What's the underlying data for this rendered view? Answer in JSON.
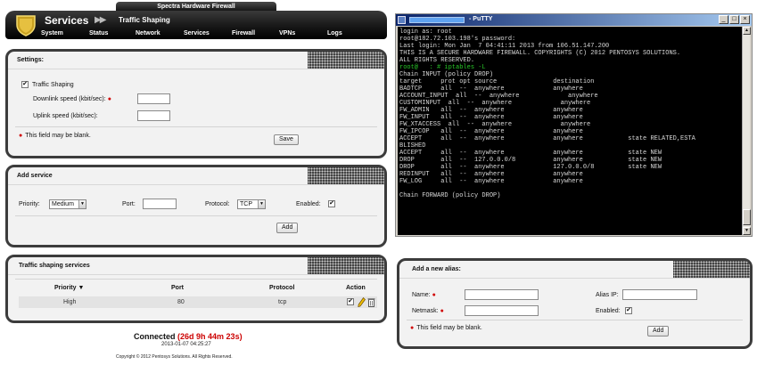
{
  "app": {
    "product_name": "Spectra Hardware Firewall",
    "section": "Services",
    "page": "Traffic Shaping",
    "nav": [
      "System",
      "Status",
      "Network",
      "Services",
      "Firewall",
      "VPNs",
      "Logs"
    ]
  },
  "settings": {
    "title": "Settings:",
    "traffic_shaping_label": "Traffic Shaping",
    "traffic_shaping_checked": true,
    "downlink_label": "Downlink speed (kbit/sec):",
    "downlink_value": "",
    "uplink_label": "Uplink speed (kbit/sec):",
    "uplink_value": "",
    "blank_note": "This field may be blank.",
    "save_label": "Save"
  },
  "add_service": {
    "title": "Add service",
    "priority_label": "Priority:",
    "priority_value": "Medium",
    "port_label": "Port:",
    "port_value": "",
    "protocol_label": "Protocol:",
    "protocol_value": "TCP",
    "enabled_label": "Enabled:",
    "enabled_checked": true,
    "add_label": "Add"
  },
  "services_table": {
    "title": "Traffic shaping services",
    "columns": [
      "Priority",
      "Port",
      "Protocol",
      "Action"
    ],
    "sort_indicator": "▼",
    "rows": [
      {
        "priority": "High",
        "port": "80",
        "protocol": "tcp"
      }
    ]
  },
  "status": {
    "connected_label": "Connected",
    "uptime": "(26d 9h 44m 23s)",
    "date": "2013-01-07 04:25:27",
    "copyright": "Copyright © 2012 Pentosys Solutions. All Rights Reserved."
  },
  "alias": {
    "title": "Add a new alias:",
    "name_label": "Name:",
    "name_value": "",
    "alias_ip_label": "Alias IP:",
    "alias_ip_value": "",
    "netmask_label": "Netmask:",
    "netmask_value": "",
    "enabled_label": "Enabled:",
    "enabled_checked": true,
    "blank_note": "This field may be blank.",
    "add_label": "Add"
  },
  "putty": {
    "title": "- PuTTY",
    "lines": [
      "login as: root",
      "root@182.72.103.198's password:",
      "Last login: Mon Jan  7 04:41:11 2013 from 106.51.147.200",
      "THIS IS A SECURE HARDWARE FIREWALL. COPYRIGHTS (C) 2012 PENTOSYS SOLUTIONS.",
      "ALL RIGHTS RESERVED.",
      "root@   : # iptables -L",
      "Chain INPUT (policy DROP)",
      "target     prot opt source               destination",
      "BADTCP     all  --  anywhere             anywhere",
      "ACCOUNT_INPUT  all  --  anywhere             anywhere",
      "CUSTOMINPUT  all  --  anywhere             anywhere",
      "FW_ADMIN   all  --  anywhere             anywhere",
      "FW_INPUT   all  --  anywhere             anywhere",
      "FW_XTACCESS  all  --  anywhere             anywhere",
      "FW_IPCOP   all  --  anywhere             anywhere",
      "ACCEPT     all  --  anywhere             anywhere            state RELATED,ESTA",
      "BLISHED",
      "ACCEPT     all  --  anywhere             anywhere            state NEW",
      "DROP       all  --  127.0.0.0/8          anywhere            state NEW",
      "DROP       all  --  anywhere             127.0.0.0/8         state NEW",
      "REDINPUT   all  --  anywhere             anywhere",
      "FW_LOG     all  --  anywhere             anywhere",
      "",
      "Chain FORWARD (policy DROP)"
    ]
  },
  "colors": {
    "header_bg": "#1a1a1a",
    "panel_border": "#3c3c3c",
    "required_red": "#d00000",
    "uptime_red": "#cc0000",
    "terminal_bg": "#000000",
    "terminal_prompt_green": "#28c828",
    "putty_titlebar": "#0a246a"
  },
  "icons": {
    "logo": "shield-logo-icon",
    "required": "required-dot-icon",
    "edit": "edit-pencil-icon",
    "delete": "trash-icon",
    "toggle": "checkbox-icon"
  }
}
